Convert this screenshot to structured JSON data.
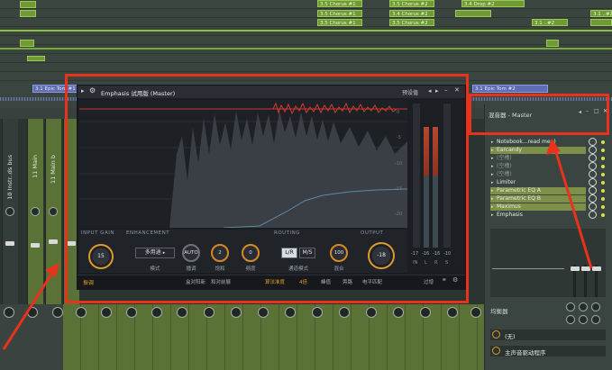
{
  "playlist": {
    "clips_top": [
      {
        "label": "3.5 Chorus #1"
      },
      {
        "label": "3.5 Chorus #1"
      },
      {
        "label": "3.5 Chorus #2"
      },
      {
        "label": "3.4 Chorus #2"
      },
      {
        "label": "3.5 Chorus #1"
      },
      {
        "label": "3.5 Chorus #2"
      },
      {
        "label": "3.4 Drop #2"
      },
      {
        "label": "3.1 ..#2"
      },
      {
        "label": "3.1 ..#2"
      }
    ],
    "pattern_left": "3.1 Epic Tom #1",
    "pattern_right": "3.1 Epic Tom #2"
  },
  "mixer": {
    "strips": [
      {
        "name": "10 Instr..ds bus"
      },
      {
        "name": "11 Main"
      },
      {
        "name": "11 Main b"
      }
    ]
  },
  "plugin": {
    "title": "Emphasis 试用版 (Master)",
    "preset_label": "预设值",
    "db_marks": [
      "0",
      "-5",
      "-10",
      "-15",
      "-20"
    ],
    "meter_values": [
      "-17",
      "-16",
      "-16",
      "-10"
    ],
    "meter_labels": [
      "IN",
      "L",
      "R",
      "S"
    ],
    "sections": {
      "input_gain": "INPUT GAIN",
      "enhancement": "ENHANCEMENT",
      "routing": "ROUTING",
      "output": "OUTPUT"
    },
    "input_knob": "15",
    "mode_select": "多用途",
    "auto_btn": "AUTO",
    "knob2": "2",
    "knob0": "0",
    "lr_btn": "L/R",
    "ms_btn": "M/S",
    "routing_knob": "100",
    "output_knob": "-18",
    "labels": {
      "mode": "模式",
      "harmonic": "播调",
      "amount": "饱和",
      "tone": "频度",
      "channel_mode": "通道模式",
      "mix": "混合",
      "output_gain": "增益"
    },
    "bottom": {
      "brand": "振调",
      "compare": "盒对阳新",
      "undo": "和对前展",
      "quality": "算法准度",
      "ratio": "4倍",
      "oversampling": "峰值",
      "bypass": "旁路",
      "level": "电平匹配",
      "gain_link": "过增"
    }
  },
  "panel": {
    "title": "混音器 - Master",
    "slots": [
      {
        "label": "Notebook...read me :)",
        "state": "on"
      },
      {
        "label": "Earcandy",
        "state": "hl"
      },
      {
        "label": "(空槽)",
        "state": "off"
      },
      {
        "label": "(空槽)",
        "state": "off"
      },
      {
        "label": "(空槽)",
        "state": "off"
      },
      {
        "label": "Limiter",
        "state": "on"
      },
      {
        "label": "Parametric EQ A",
        "state": "hl"
      },
      {
        "label": "Parametric EQ B",
        "state": "hl"
      },
      {
        "label": "Maximus",
        "state": "hl"
      },
      {
        "label": "Emphasis",
        "state": "on"
      }
    ],
    "eq_label": "均衡器",
    "route_label": "(无)",
    "output_label": "主声音驱动程序"
  },
  "colors": {
    "accent_orange": "#e09a2c",
    "highlight_red": "#e8321c",
    "mixer_green": "#5b7236"
  }
}
